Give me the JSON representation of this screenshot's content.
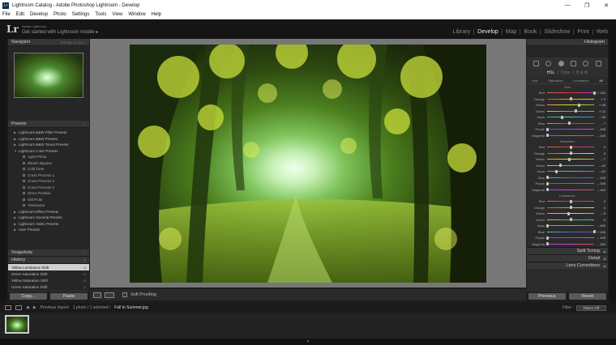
{
  "window": {
    "title": "Lightroom Catalog - Adobe Photoshop Lightroom - Develop",
    "app_icon": "Lr",
    "controls": {
      "minimize": "—",
      "maximize": "❐",
      "close": "✕"
    }
  },
  "menu": [
    "File",
    "Edit",
    "Develop",
    "Photo",
    "Settings",
    "Tools",
    "View",
    "Window",
    "Help"
  ],
  "identity": {
    "logo": "Lr",
    "line1": "Adobe Lightroom",
    "line2": "Get started with Lightroom mobile ▸"
  },
  "modules": [
    {
      "label": "Library"
    },
    {
      "label": "Develop",
      "active": true
    },
    {
      "label": "Map"
    },
    {
      "label": "Book"
    },
    {
      "label": "Slideshow"
    },
    {
      "label": "Print"
    },
    {
      "label": "Web"
    }
  ],
  "left": {
    "navigator": {
      "title": "Navigator",
      "zoom": "FIT  FILL  1:1  3:1 ÷"
    },
    "presets": {
      "title": "Presets",
      "items": [
        {
          "label": "Lightroom B&W Filter Presets",
          "child": false
        },
        {
          "label": "Lightroom B&W Presets",
          "child": false
        },
        {
          "label": "Lightroom B&W Toned Presets",
          "child": false
        },
        {
          "label": "Lightroom Color Presets",
          "child": false,
          "open": true
        },
        {
          "label": "Aged Photo",
          "child": true
        },
        {
          "label": "Bleach Bypass",
          "child": true
        },
        {
          "label": "Cold Tone",
          "child": true
        },
        {
          "label": "Cross Process 1",
          "child": true
        },
        {
          "label": "Cross Process 2",
          "child": true
        },
        {
          "label": "Cross Process 3",
          "child": true
        },
        {
          "label": "Direct Positive",
          "child": true
        },
        {
          "label": "Old Polar",
          "child": true
        },
        {
          "label": "Yesteryear",
          "child": true
        },
        {
          "label": "Lightroom Effect Presets",
          "child": false
        },
        {
          "label": "Lightroom General Presets",
          "child": false
        },
        {
          "label": "Lightroom Video Presets",
          "child": false
        },
        {
          "label": "User Presets",
          "child": false
        }
      ]
    },
    "snapshots": {
      "title": "Snapshots"
    },
    "history": {
      "title": "History",
      "items": [
        {
          "label": "Yellow Luminance Shift",
          "v1": "0",
          "v2": "0",
          "selected": true
        },
        {
          "label": "Green Saturation Shift",
          "v1": "+5",
          "v2": ""
        },
        {
          "label": "Yellow Saturation Shift",
          "v1": "+5",
          "v2": ""
        },
        {
          "label": "Green Saturation Shift",
          "v1": "-5",
          "v2": ""
        }
      ]
    },
    "buttons": {
      "copy": "Copy...",
      "paste": "Paste"
    }
  },
  "toolbar": {
    "soft_proofing": "Soft Proofing"
  },
  "right": {
    "histogram": "Histogram",
    "hsl_tabs": {
      "hsl": "HSL",
      "sep1": "/",
      "color": "Color",
      "sep2": "/",
      "bw": "B & W"
    },
    "hsl_sub": [
      "Hue",
      "Saturation",
      "Luminance",
      "All"
    ],
    "sections": [
      {
        "title": "Hue",
        "rows": [
          {
            "label": "Red",
            "value": "+ 100",
            "pos": 1.0
          },
          {
            "label": "Orange",
            "value": "+ 2",
            "pos": 0.51
          },
          {
            "label": "Yellow",
            "value": "+ 35",
            "pos": 0.68
          },
          {
            "label": "Green",
            "value": "+ 22",
            "pos": 0.61
          },
          {
            "label": "Aqua",
            "value": "– 36",
            "pos": 0.32
          },
          {
            "label": "Blue",
            "value": "– 7",
            "pos": 0.47
          },
          {
            "label": "Purple",
            "value": "– 100",
            "pos": 0.0
          },
          {
            "label": "Magenta",
            "value": "– 100",
            "pos": 0.0
          }
        ]
      },
      {
        "title": "Saturation",
        "rows": [
          {
            "label": "Red",
            "value": "0",
            "pos": 0.5
          },
          {
            "label": "Orange",
            "value": "0",
            "pos": 0.5
          },
          {
            "label": "Yellow",
            "value": "– 7",
            "pos": 0.47
          },
          {
            "label": "Green",
            "value": "– 42",
            "pos": 0.29
          },
          {
            "label": "Aqua",
            "value": "– 62",
            "pos": 0.19
          },
          {
            "label": "Blue",
            "value": "– 100",
            "pos": 0.0
          },
          {
            "label": "Purple",
            "value": "– 100",
            "pos": 0.0
          },
          {
            "label": "Magenta",
            "value": "– 100",
            "pos": 0.0
          }
        ]
      },
      {
        "title": "Luminance",
        "rows": [
          {
            "label": "Red",
            "value": "0",
            "pos": 0.5
          },
          {
            "label": "Orange",
            "value": "0",
            "pos": 0.5
          },
          {
            "label": "Yellow",
            "value": "– 9",
            "pos": 0.46
          },
          {
            "label": "Green",
            "value": "0",
            "pos": 0.5
          },
          {
            "label": "Aqua",
            "value": "– 100",
            "pos": 0.0
          },
          {
            "label": "Blue",
            "value": "+ 100",
            "pos": 1.0
          },
          {
            "label": "Purple",
            "value": "– 100",
            "pos": 0.0
          },
          {
            "label": "Magenta",
            "value": "– 100",
            "pos": 0.0
          }
        ]
      }
    ],
    "split_toning": "Split Toning",
    "detail": "Detail",
    "lens": "Lens Corrections",
    "buttons": {
      "previous": "Previous",
      "reset": "Reset"
    }
  },
  "filmbar": {
    "source": "Previous Import",
    "count": "1 photo / 1 selected /",
    "filename": "Fall to Summer.jpg",
    "filter_label": "Filter :",
    "filter_value": "Filters Off"
  },
  "colors": {
    "accent": "#cfcfcf",
    "panel": "#2b2b2b",
    "canvas": "#777777"
  }
}
